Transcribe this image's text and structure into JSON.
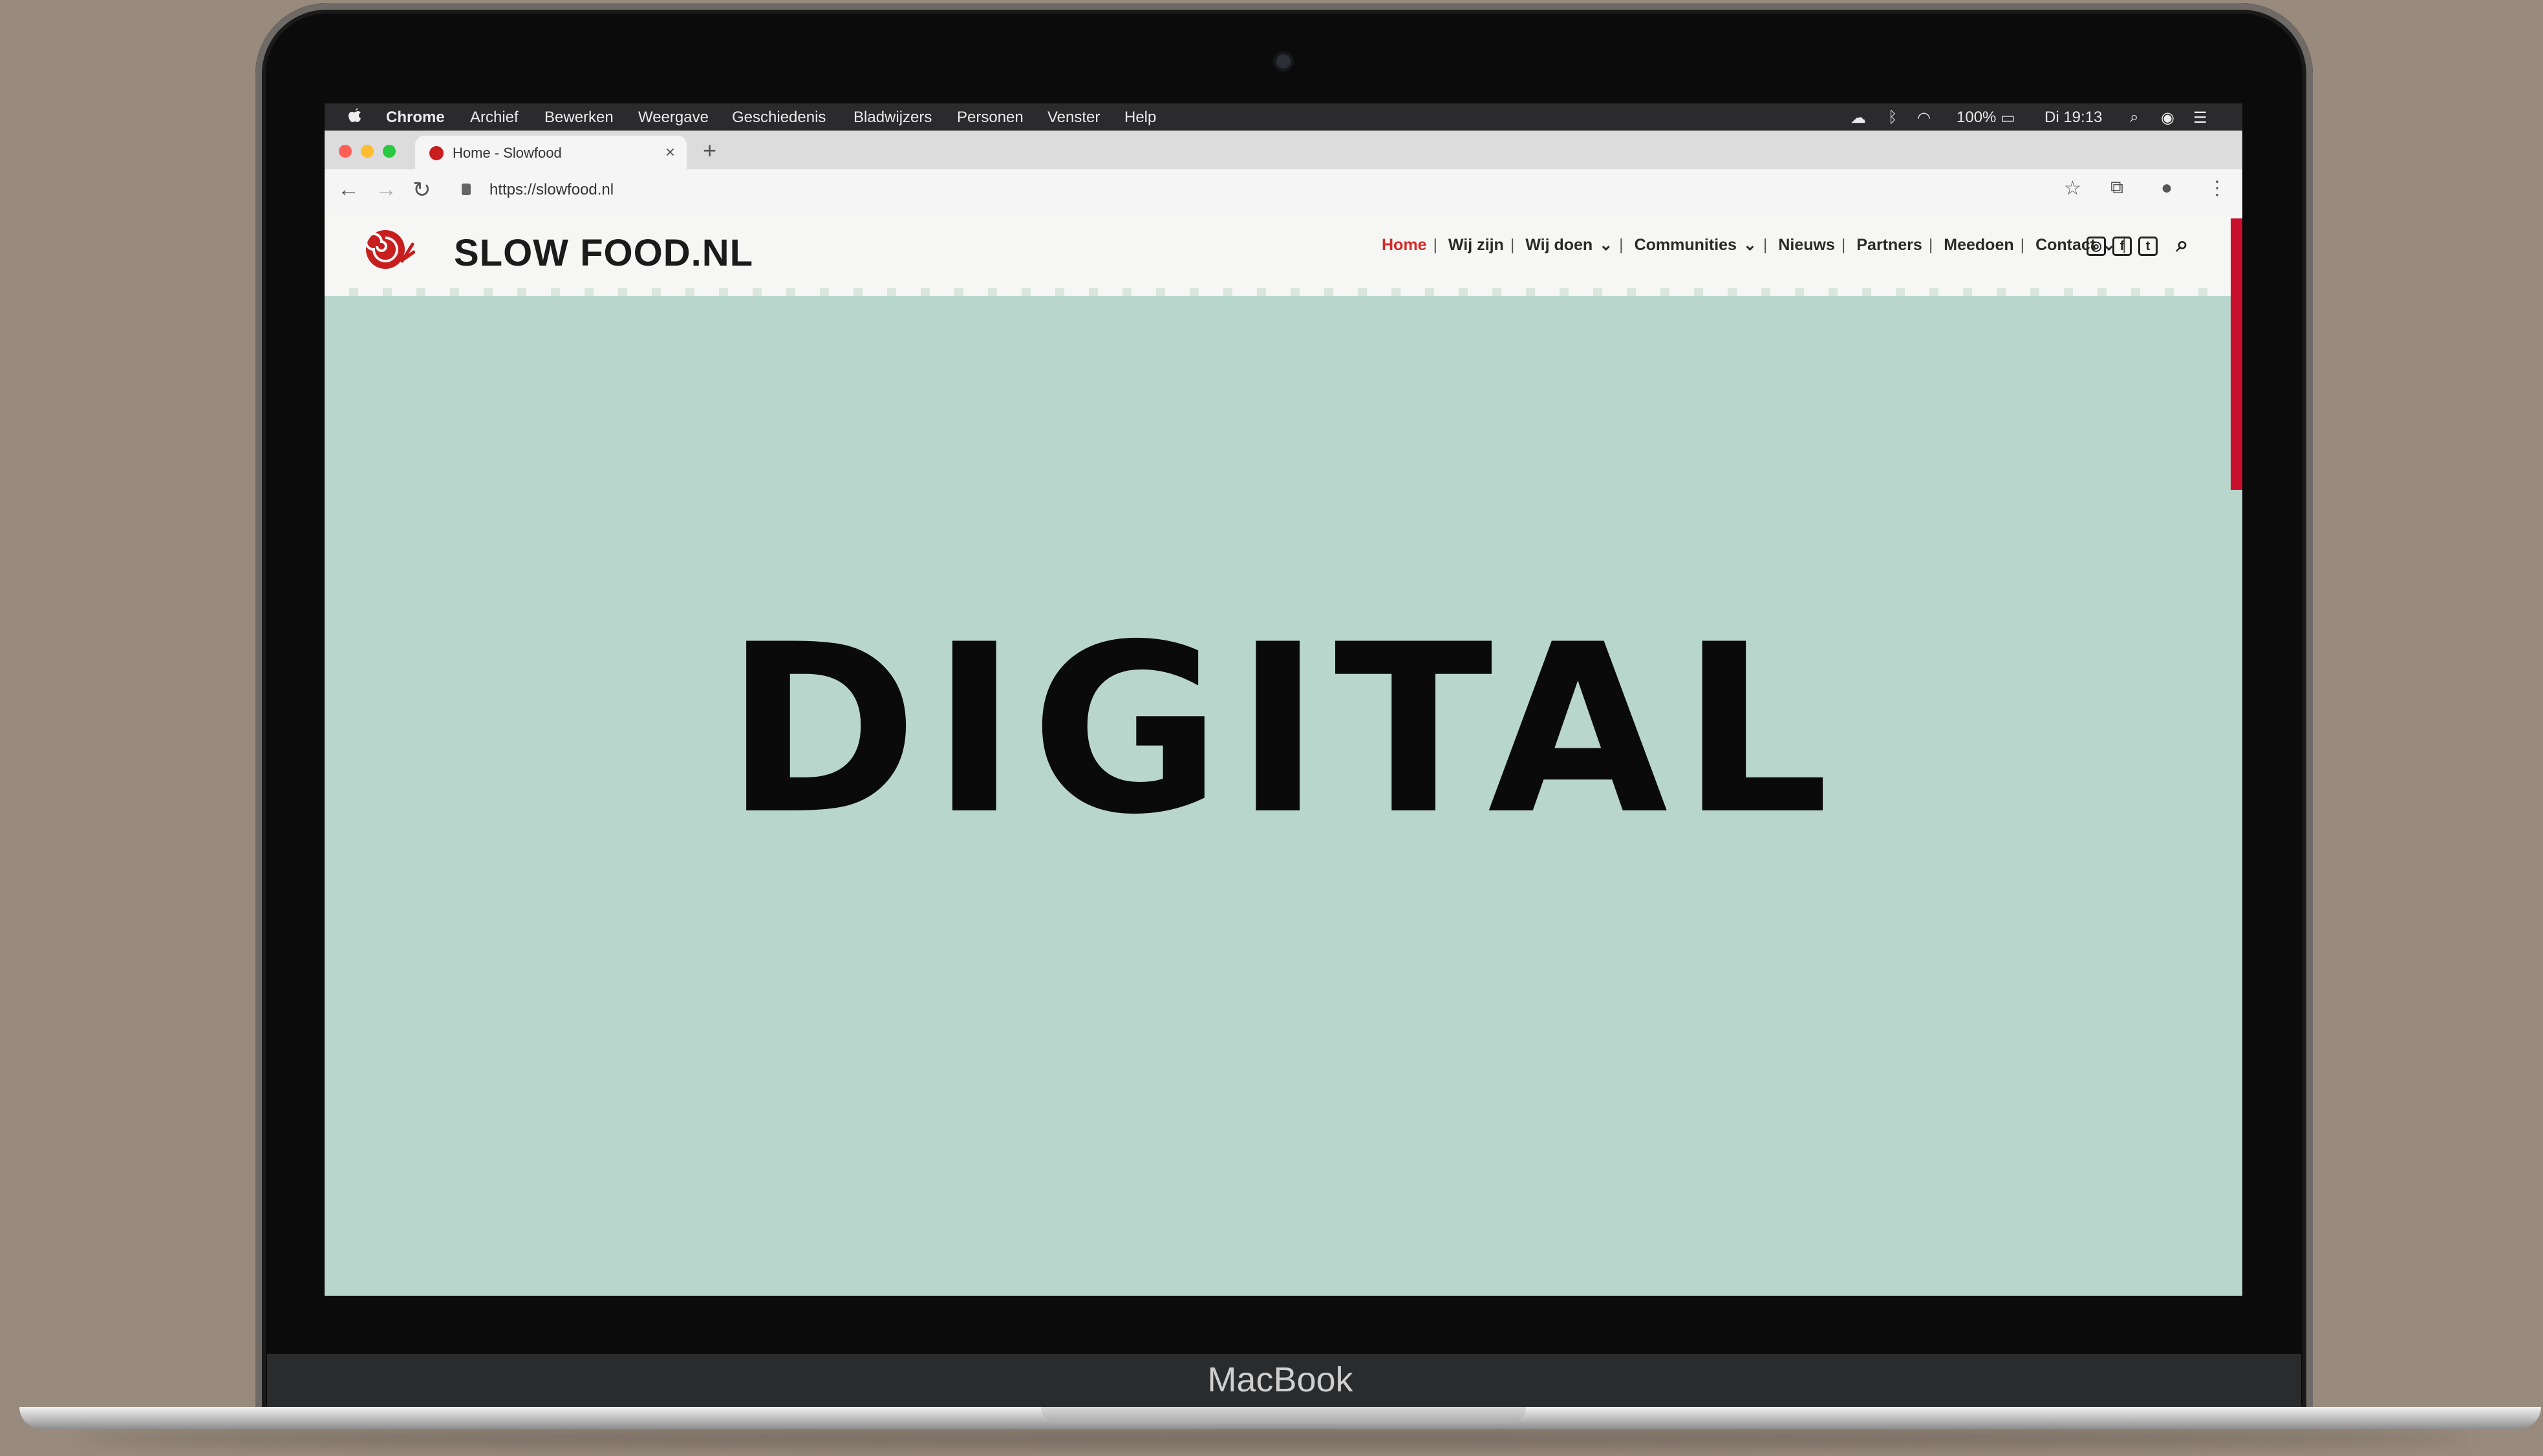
{
  "menubar": {
    "items": [
      "Chrome",
      "Archief",
      "Bewerken",
      "Weergave",
      "Geschiedenis",
      "Bladwijzers",
      "Personen",
      "Venster",
      "Help"
    ],
    "battery": "100%",
    "clock": "Di 19:13"
  },
  "browser": {
    "tab_title": "Home - Slowfood",
    "url": "https://slowfood.nl"
  },
  "site": {
    "logo_text": "SLOW FOOD.NL",
    "nav": [
      "Home",
      "Wij zijn",
      "Wij doen",
      "Communities",
      "Nieuws",
      "Partners",
      "Meedoen",
      "Contact"
    ],
    "hero_text": "DIGITAL"
  },
  "device": {
    "label": "MacBook"
  },
  "colors": {
    "accent": "#c8102e",
    "hero_bg": "#b8d6cc",
    "active_nav": "#d42a2a"
  }
}
